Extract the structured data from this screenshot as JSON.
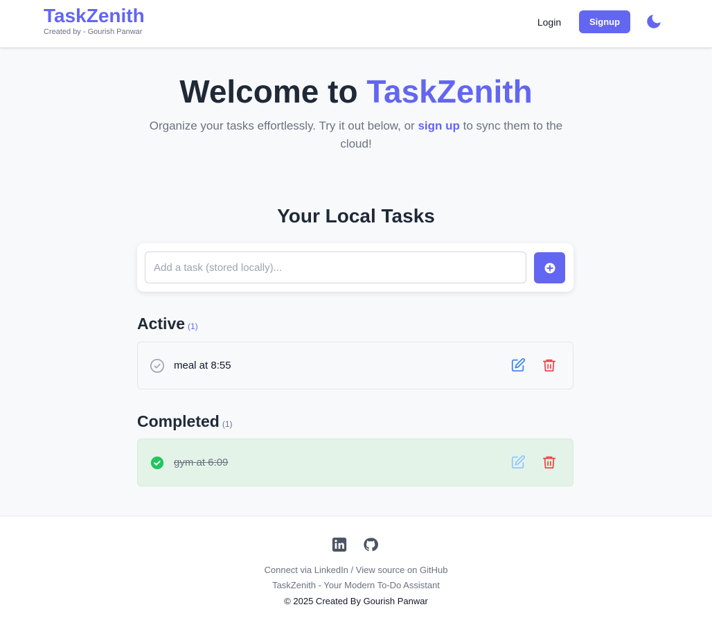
{
  "header": {
    "brand": "TaskZenith",
    "byline": "Created by - Gourish Panwar",
    "login_label": "Login",
    "signup_label": "Signup",
    "theme_icon": "moon-icon"
  },
  "hero": {
    "title_prefix": "Welcome to ",
    "title_accent": "TaskZenith",
    "subtitle_before": "Organize your tasks effortlessly. Try it out below, or ",
    "subtitle_link": "sign up",
    "subtitle_after": " to sync them to the cloud!"
  },
  "tasks_section": {
    "title": "Your Local Tasks",
    "input_placeholder": "Add a task (stored locally)...",
    "input_value": "",
    "add_icon": "plus-circle-icon"
  },
  "active": {
    "heading": "Active",
    "count": "(1)",
    "items": [
      {
        "text": "meal at 8:55",
        "completed": false
      }
    ]
  },
  "completed": {
    "heading": "Completed",
    "count": "(1)",
    "items": [
      {
        "text": "gym at 6:09",
        "completed": true
      }
    ]
  },
  "footer": {
    "social_icons": [
      "linkedin-icon",
      "github-icon"
    ],
    "connect_link": "Connect via LinkedIn",
    "separator": " / ",
    "source_link": "View source on GitHub",
    "tagline": "TaskZenith - Your Modern To-Do Assistant",
    "copyright": "© 2025 Created By Gourish Panwar"
  },
  "colors": {
    "accent": "#6366f1",
    "danger": "#ef4444",
    "success": "#22c55e",
    "completed_bg": "#e3f3e8"
  }
}
